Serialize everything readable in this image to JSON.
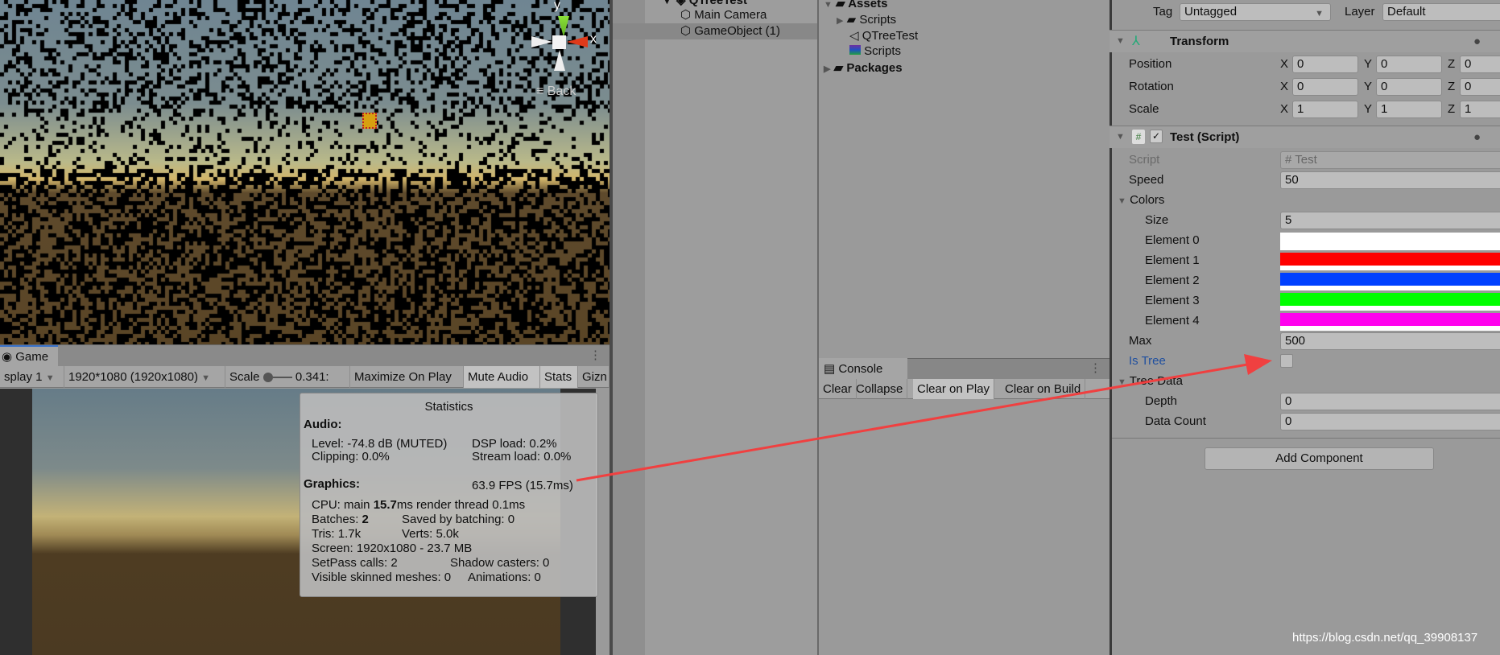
{
  "scene": {
    "axis_x": "x",
    "axis_y": "y",
    "back_label": "Back"
  },
  "game": {
    "tab": "Game",
    "display": "splay 1",
    "resolution": "1920*1080 (1920x1080)",
    "scale_label": "Scale",
    "scale_value": "0.341:",
    "maximize": "Maximize On Play",
    "mute": "Mute Audio",
    "stats": "Stats",
    "gizmos": "Gizn"
  },
  "statistics": {
    "title": "Statistics",
    "audio_header": "Audio:",
    "level": "Level: -74.8 dB (MUTED)",
    "dsp": "DSP load: 0.2%",
    "clipping": "Clipping: 0.0%",
    "stream": "Stream load: 0.0%",
    "graphics_header": "Graphics:",
    "fps": "63.9 FPS (15.7ms)",
    "cpu_a": "CPU: main ",
    "cpu_b": "15.7",
    "cpu_c": "ms  render thread 0.1ms",
    "batches_a": "Batches: ",
    "batches_b": "2",
    "saved": "Saved by batching: 0",
    "tris": "Tris: 1.7k",
    "verts": "Verts: 5.0k",
    "screen": "Screen: 1920x1080 - 23.7 MB",
    "setpass": "SetPass calls: 2",
    "shadow": "Shadow casters: 0",
    "skinned": "Visible skinned meshes: 0",
    "animations": "Animations: 0"
  },
  "hierarchy": {
    "scene": "QTreeTest",
    "items": [
      "Main Camera",
      "GameObject (1)"
    ]
  },
  "project": {
    "assets": "Assets",
    "items": [
      "Scripts",
      "QTreeTest",
      "Scripts"
    ],
    "packages": "Packages"
  },
  "console": {
    "tab": "Console",
    "buttons": [
      "Clear",
      "Collapse",
      "Clear on Play",
      "Clear on Build"
    ]
  },
  "inspector": {
    "tag_label": "Tag",
    "tag": "Untagged",
    "layer_label": "Layer",
    "layer": "Default",
    "transform": {
      "title": "Transform",
      "rows": [
        {
          "label": "Position",
          "x": "0",
          "y": "0",
          "z": "0"
        },
        {
          "label": "Rotation",
          "x": "0",
          "y": "0",
          "z": "0"
        },
        {
          "label": "Scale",
          "x": "1",
          "y": "1",
          "z": "1"
        }
      ]
    },
    "script": {
      "title": "Test (Script)",
      "enabled": true,
      "script_label": "Script",
      "script": "Test",
      "speed_label": "Speed",
      "speed": "50",
      "colors_label": "Colors",
      "size_label": "Size",
      "size": "5",
      "elements": [
        {
          "label": "Element 0",
          "color": "#ffffff"
        },
        {
          "label": "Element 1",
          "color": "#ff0000"
        },
        {
          "label": "Element 2",
          "color": "#0040ff"
        },
        {
          "label": "Element 3",
          "color": "#00ff00"
        },
        {
          "label": "Element 4",
          "color": "#ff00ee"
        }
      ],
      "max_label": "Max",
      "max": "500",
      "is_tree_label": "Is Tree",
      "is_tree": false,
      "tree_data_label": "Tree Data",
      "depth_label": "Depth",
      "depth": "0",
      "data_count_label": "Data Count",
      "data_count": "0"
    },
    "add_component": "Add Component"
  },
  "watermark": "https://blog.csdn.net/qq_39908137",
  "annotation_color": "#f04040"
}
